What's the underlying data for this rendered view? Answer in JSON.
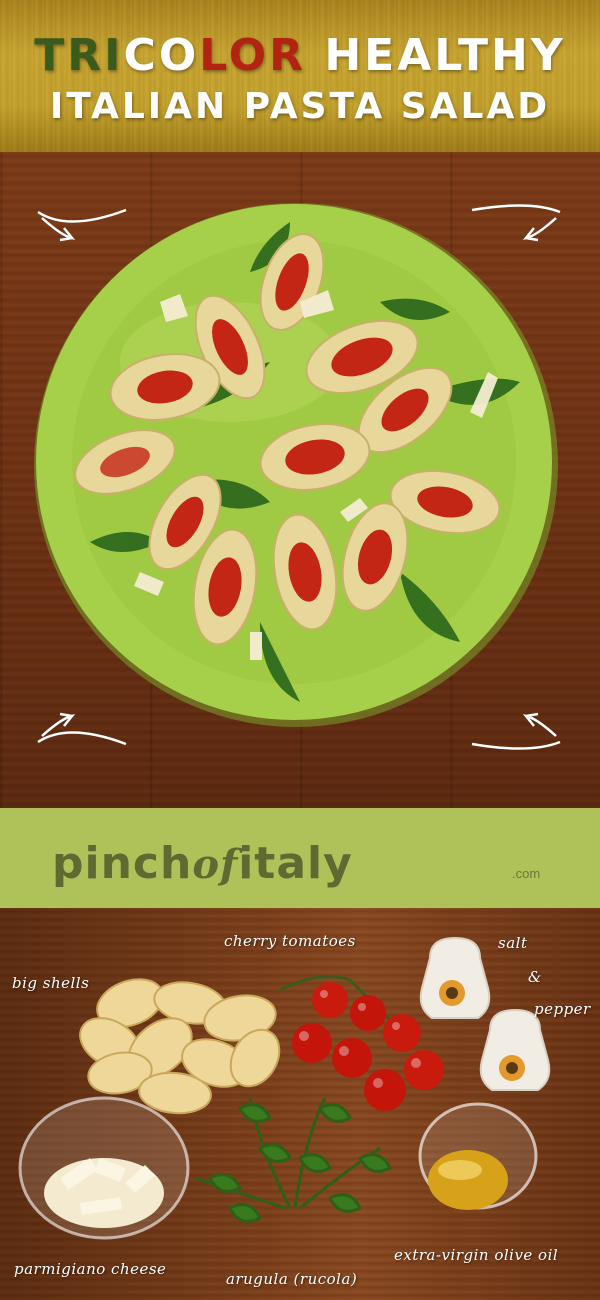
{
  "title": {
    "line1_parts": [
      "TRI",
      "CO",
      "LOR",
      " HEALTHY"
    ],
    "line2": "ITALIAN PASTA SALAD"
  },
  "brand": {
    "name_part1": "pinch",
    "name_part2": "of",
    "name_part3": "italy",
    "suffix": ".com"
  },
  "ingredients": {
    "big_shells": "big shells",
    "cherry_tomatoes": "cherry tomatoes",
    "salt": "salt",
    "and": "&",
    "pepper": "pepper",
    "parmigiano": "parmigiano cheese",
    "arugula": "arugula (rucola)",
    "olive_oil": "extra-virgin olive oil"
  },
  "colors": {
    "green": "#3b5b1d",
    "red": "#b22312",
    "brand_band": "#afc25a",
    "plate": "#a6d04a"
  },
  "icons": [
    "curved-arrow-icon"
  ]
}
